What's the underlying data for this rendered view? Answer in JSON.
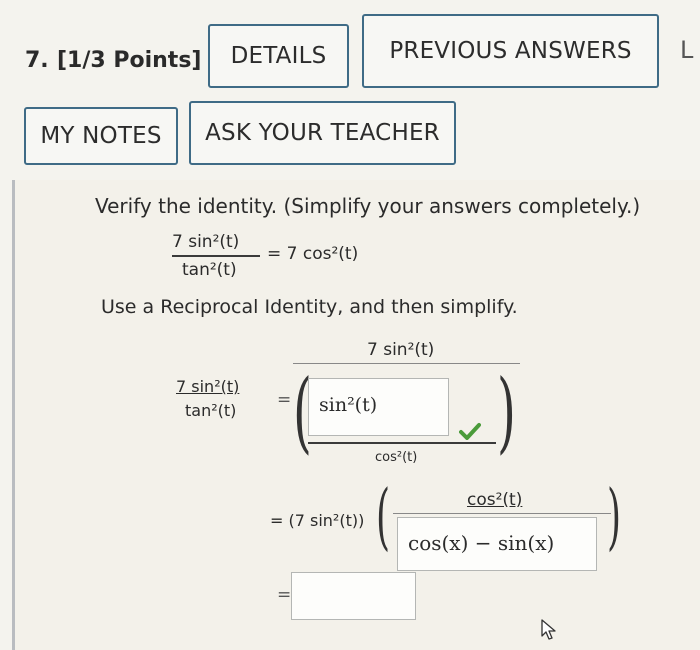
{
  "question": {
    "number_label": "7.",
    "points_label": "[1/3 Points]",
    "cut_label": "L"
  },
  "buttons": {
    "details": "DETAILS",
    "previous_answers": "PREVIOUS ANSWERS",
    "my_notes": "MY NOTES",
    "ask_teacher": "ASK YOUR TEACHER"
  },
  "problem": {
    "instruction": "Verify the identity. (Simplify your answers completely.)",
    "identity_num": "7 sin²(t)",
    "identity_den": "tan²(t)",
    "identity_rhs": "= 7 cos²(t)",
    "step_instruction": "Use a Reciprocal Identity, and then simplify."
  },
  "work": {
    "lhs_num": "7 sin²(t)",
    "lhs_den": "tan²(t)",
    "eq1": "=",
    "big_num": "7 sin²(t)",
    "answer1_value": "sin²(t)",
    "answer1_den": "cos²(t)",
    "eq2": "= (7 sin²(t))",
    "inner_num": "cos²(t)",
    "answer2_value": "cos(x) − sin(x)",
    "eq3": "=",
    "answer3_value": ""
  },
  "colors": {
    "button_border": "#3f6b86",
    "correct_check": "#4a9b3a"
  }
}
